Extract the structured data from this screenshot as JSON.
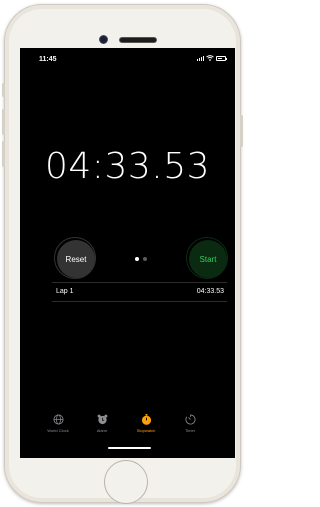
{
  "status_bar": {
    "time": "11:45"
  },
  "stopwatch": {
    "display": "04:33.53",
    "reset_label": "Reset",
    "start_label": "Start",
    "page_dots": 2,
    "active_page": 1
  },
  "laps": [
    {
      "label": "Lap 1",
      "time": "04:33.53"
    }
  ],
  "tabs": [
    {
      "label": "World Clock",
      "icon": "globe-icon",
      "active": false
    },
    {
      "label": "Alarm",
      "icon": "alarm-clock-icon",
      "active": false
    },
    {
      "label": "Stopwatch",
      "icon": "stopwatch-icon",
      "active": true
    },
    {
      "label": "Timer",
      "icon": "timer-icon",
      "active": false
    }
  ],
  "colors": {
    "background": "#000000",
    "accent_active_tab": "#ff9f0a",
    "start_green": "#30d158",
    "reset_gray": "#333333",
    "device_frame": "#f3f1ec"
  }
}
